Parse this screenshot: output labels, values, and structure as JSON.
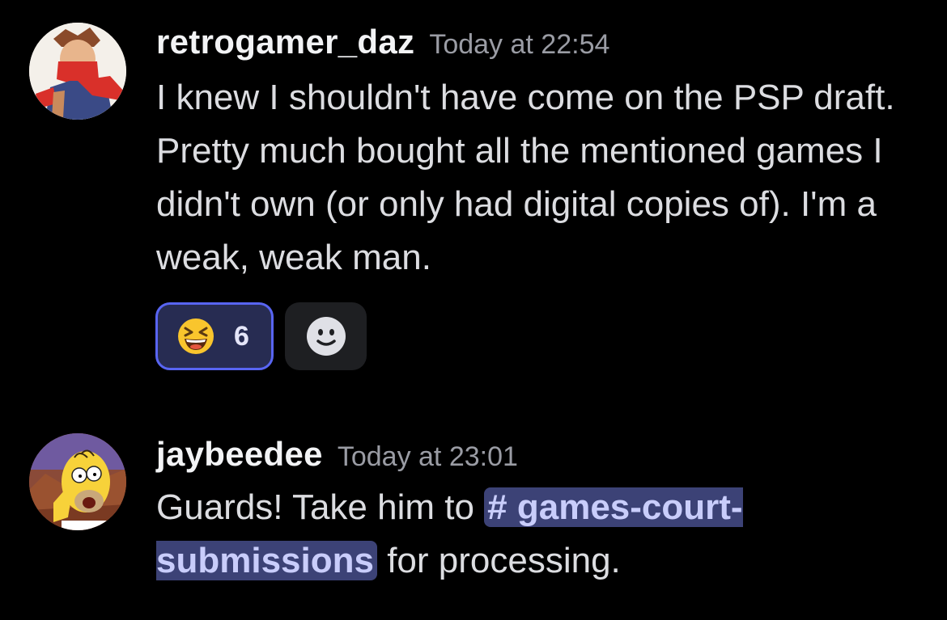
{
  "messages": [
    {
      "username": "retrogamer_daz",
      "timestamp": "Today at 22:54",
      "text": "I knew I shouldn't have come on the PSP draft. Pretty much bought all the mentioned games I didn't own (or only had digital copies of). I'm a weak, weak man.",
      "avatar_icon": "ninja-character-avatar",
      "reactions": [
        {
          "emoji": "laughing-squinting-emoji",
          "count": "6",
          "selected": true
        },
        {
          "emoji": "add-reaction-smiley-icon"
        }
      ]
    },
    {
      "username": "jaybeedee",
      "timestamp": "Today at 23:01",
      "text_before": "Guards! Take him to ",
      "channel_mention": "# games-court-submissions",
      "text_after": " for processing.",
      "avatar_icon": "homer-simpson-avatar"
    }
  ],
  "colors": {
    "background": "#000000",
    "mention_bg": "#3c4276",
    "mention_text": "#c9cdfb",
    "reaction_selected_border": "#5865f2",
    "reaction_selected_bg": "#272c52"
  }
}
